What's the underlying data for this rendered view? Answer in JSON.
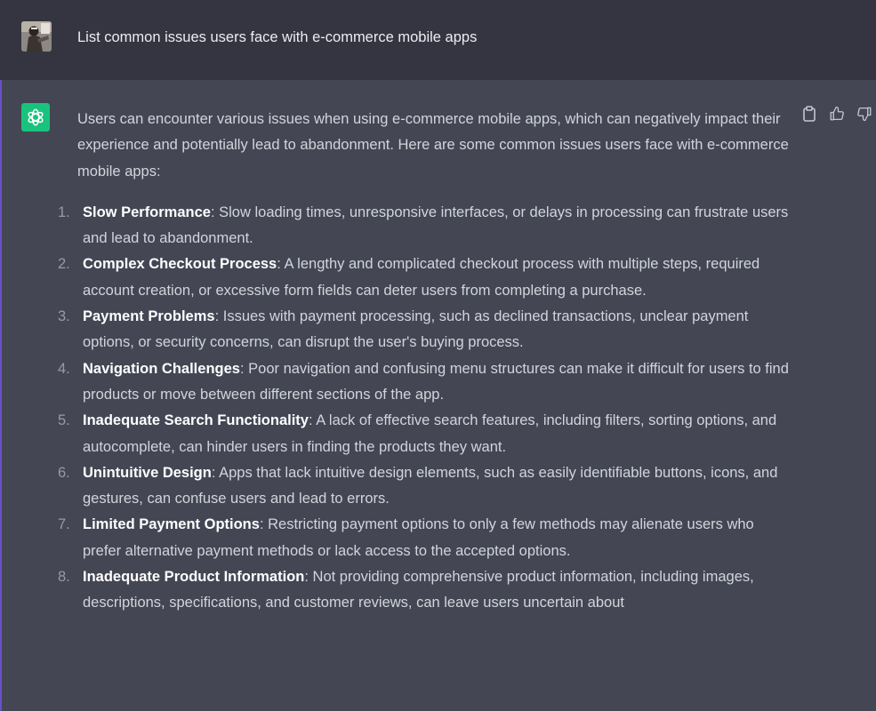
{
  "user_message": {
    "text": "List common issues users face with e-commerce mobile apps"
  },
  "assistant_message": {
    "intro": "Users can encounter various issues when using e-commerce mobile apps, which can negatively impact their experience and potentially lead to abandonment. Here are some common issues users face with e-commerce mobile apps:",
    "items": [
      {
        "number": "1.",
        "title": "Slow Performance",
        "text": ": Slow loading times, unresponsive interfaces, or delays in processing can frustrate users and lead to abandonment."
      },
      {
        "number": "2.",
        "title": "Complex Checkout Process",
        "text": ": A lengthy and complicated checkout process with multiple steps, required account creation, or excessive form fields can deter users from completing a purchase."
      },
      {
        "number": "3.",
        "title": "Payment Problems",
        "text": ": Issues with payment processing, such as declined transactions, unclear payment options, or security concerns, can disrupt the user's buying process."
      },
      {
        "number": "4.",
        "title": "Navigation Challenges",
        "text": ": Poor navigation and confusing menu structures can make it difficult for users to find products or move between different sections of the app."
      },
      {
        "number": "5.",
        "title": "Inadequate Search Functionality",
        "text": ": A lack of effective search features, including filters, sorting options, and autocomplete, can hinder users in finding the products they want."
      },
      {
        "number": "6.",
        "title": "Unintuitive Design",
        "text": ": Apps that lack intuitive design elements, such as easily identifiable buttons, icons, and gestures, can confuse users and lead to errors."
      },
      {
        "number": "7.",
        "title": "Limited Payment Options",
        "text": ": Restricting payment options to only a few methods may alienate users who prefer alternative payment methods or lack access to the accepted options."
      },
      {
        "number": "8.",
        "title": "Inadequate Product Information",
        "text": ": Not providing comprehensive product information, including images, descriptions, specifications, and customer reviews, can leave users uncertain about"
      }
    ]
  },
  "icons": {
    "copy": "clipboard-icon",
    "like": "thumbs-up-icon",
    "dislike": "thumbs-down-icon",
    "assistant_logo": "openai-logo-icon"
  },
  "colors": {
    "user_bg": "#343541",
    "assistant_bg": "#444654",
    "logo_bg": "#19c37d",
    "text": "#d1d5db",
    "bold": "#ffffff"
  }
}
